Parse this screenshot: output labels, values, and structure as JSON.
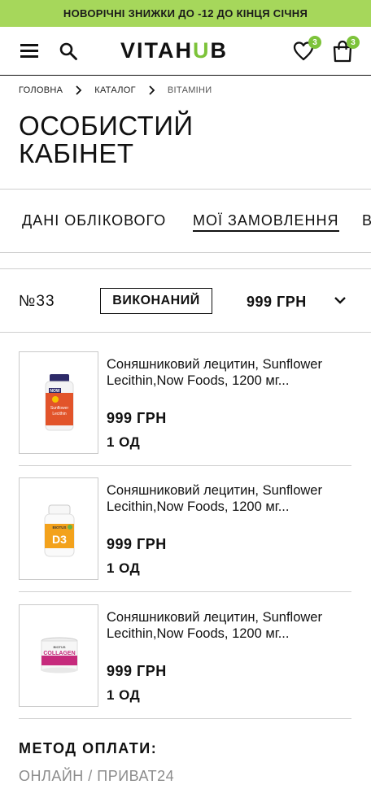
{
  "promo_banner": "НОВОРІЧНІ ЗНИЖКИ ДО -12 ДО КІНЦЯ СІЧНЯ",
  "header": {
    "logo_main": "VITAH",
    "logo_accent": "U",
    "logo_end": "B",
    "wishlist_count": "3",
    "cart_count": "3"
  },
  "breadcrumb": [
    "ГОЛОВНА",
    "КАТАЛОГ",
    "ВІТАМІНИ"
  ],
  "page_title": "ОСОБИСТИЙ КАБІНЕТ",
  "tabs": [
    {
      "label": "ДАНІ ОБЛІКОВОГО"
    },
    {
      "label": "МОЇ ЗАМОВЛЕННЯ"
    },
    {
      "label": "В"
    }
  ],
  "order": {
    "number": "№33",
    "status": "ВИКОНАНИЙ",
    "total": "999 ГРН"
  },
  "items": [
    {
      "name": "Соняшниковий лецитин, Sunflower Lecithin,Now Foods, 1200 мг...",
      "price": "999 ГРН",
      "qty": "1 ОД"
    },
    {
      "name": "Соняшниковий лецитин, Sunflower Lecithin,Now Foods, 1200 мг...",
      "price": "999 ГРН",
      "qty": "1 ОД"
    },
    {
      "name": "Соняшниковий лецитин, Sunflower Lecithin,Now Foods, 1200 мг...",
      "price": "999 ГРН",
      "qty": "1 ОД"
    }
  ],
  "product_labels": {
    "now_brand": "NOW",
    "now_line1": "Sunflower",
    "now_line2": "Lecithin",
    "biotus_brand": "BIOTUS",
    "d3_text": "D3",
    "collagen_brand": "BIOTUS",
    "collagen_text": "COLLAGEN"
  },
  "payment": {
    "label": "МЕТОД ОПЛАТИ:",
    "value": "ОНЛАЙН / ПРИВАТ24"
  },
  "colors": {
    "accent": "#7dc33a",
    "promo_bg": "#a6d75b",
    "text": "#111111",
    "muted": "#8c8c8c"
  }
}
